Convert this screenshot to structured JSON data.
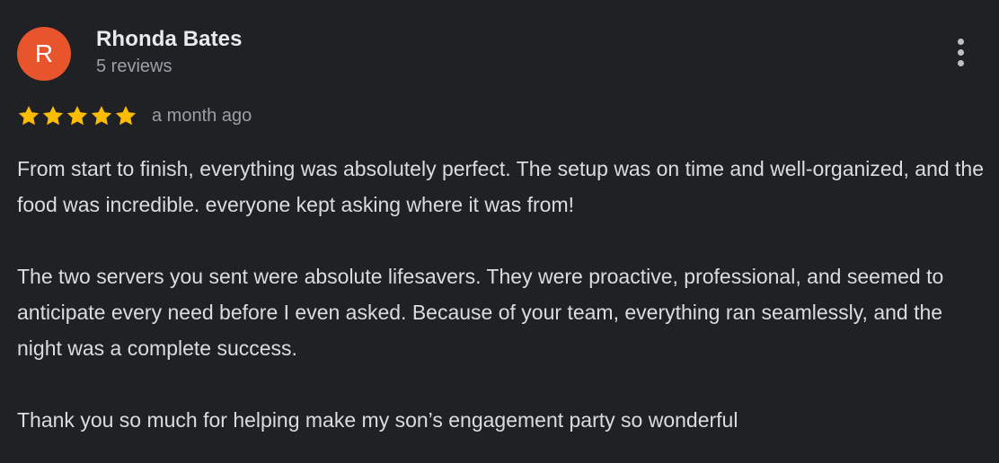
{
  "review": {
    "author": {
      "initial": "R",
      "name": "Rhonda Bates",
      "reviews_count": "5 reviews",
      "avatar_color": "#e8552d"
    },
    "rating": {
      "stars": 5,
      "max": 5,
      "star_color": "#fbbc04"
    },
    "date": "a month ago",
    "menu_icon": "more-vert-icon",
    "paragraphs": [
      "From start to finish, everything was absolutely perfect. The setup was on time and well-organized, and the food was incredible. everyone kept asking where it was from!",
      "The two servers you sent were absolute lifesavers. They were proactive, professional, and seemed to anticipate every need before I even asked. Because of your team, everything ran seamlessly, and the night was a complete success.",
      "Thank you so much for helping make my son’s engagement party so wonderful"
    ]
  }
}
